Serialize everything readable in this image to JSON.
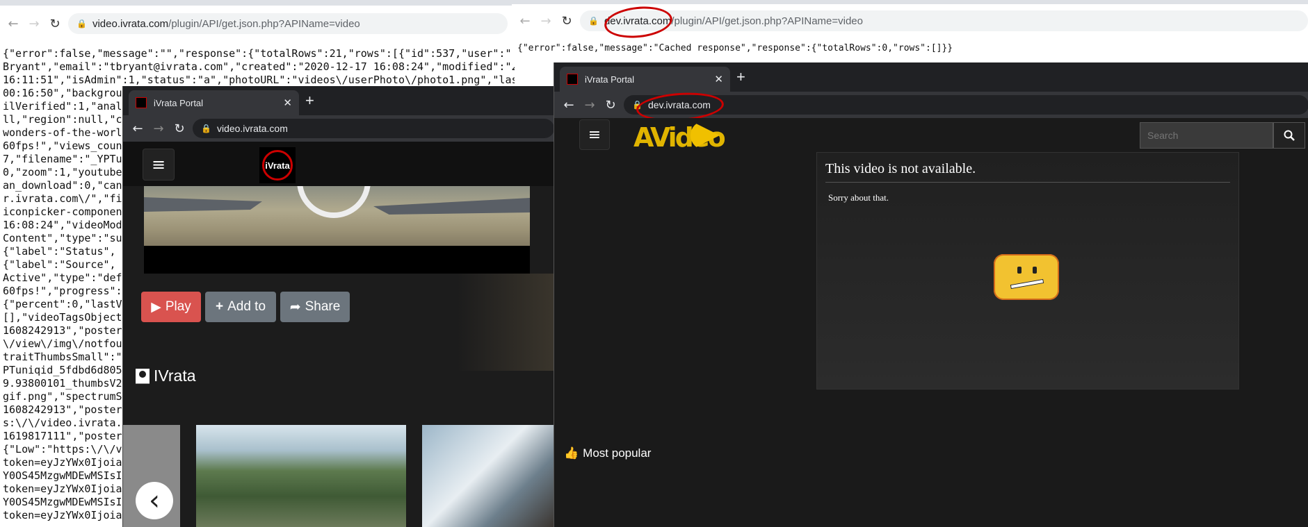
{
  "win_back": {
    "url_host": "video.ivrata.com",
    "url_path": "/plugin/API/get.json.php?APIName=video",
    "json_lines": [
      "{\"error\":false,\"message\":\"\",\"response\":{\"totalRows\":21,\"rows\":[{\"id\":537,\"user\":\"a",
      "Bryant\",\"email\":\"tbryant@ivrata.com\",\"created\":\"2020-12-17 16:08:24\",\"modified\":\"2",
      "16:11:51\",\"isAdmin\":1,\"status\":\"a\",\"photoURL\":\"videos\\/userPhoto\\/photo1.png\",\"las",
      "00:16:50\",\"backgrou",
      "ilVerified\":1,\"anal",
      "ll,\"region\":null,\"c",
      "wonders-of-the-worl",
      "60fps!\",\"views_coun",
      "7,\"filename\":\"_YPTu",
      "0,\"zoom\":1,\"youtube",
      "an_download\":0,\"can",
      "r.ivrata.com\\/\",\"fi",
      "iconpicker-componen",
      "16:08:24\",\"videoMod",
      "Content\",\"type\":\"su",
      "{\"label\":\"Status\",",
      "{\"label\":\"Source\",",
      "Active\",\"type\":\"def",
      "60fps!\",\"progress\":",
      "{\"percent\":0,\"lastV",
      "[],\"videoTagsObject",
      "1608242913\",\"poster",
      "\\/view\\/img\\/notfou",
      "traitThumbsSmall\":\"",
      "PTuniqid_5fdbd6d805",
      "9.93800101_thumbsV2",
      "gif.png\",\"spectrumS",
      "1608242913\",\"poster",
      "s:\\/\\/video.ivrata.",
      "1619817111\",\"poster",
      "{\"Low\":\"https:\\/\\/v",
      "token=eyJzYWx0Ijoia",
      "Y0OS45MzgwMDEwMSIsI",
      "token=eyJzYWx0Ijoia",
      "Y0OS45MzgwMDEwMSIsI",
      "token=eyJzYWx0Ijoia"
    ]
  },
  "win_dev": {
    "url_host": "dev.ivrata.com",
    "url_path": "/plugin/API/get.json.php?APIName=video",
    "json": "{\"error\":false,\"message\":\"Cached response\",\"response\":{\"totalRows\":0,\"rows\":[]}}"
  },
  "popup_video": {
    "tab_title": "iVrata Portal",
    "url": "video.ivrata.com",
    "logo_text": "iVrata",
    "buttons": {
      "play": "Play",
      "add": "Add to",
      "share": "Share"
    },
    "channel_name": "IVrata"
  },
  "popup_dev": {
    "tab_title": "iVrata Portal",
    "url": "dev.ivrata.com",
    "logo_text": "AVideo",
    "search_placeholder": "Search",
    "error_title": "This video is not  available.",
    "error_message": "Sorry about that.",
    "most_popular": "Most popular"
  },
  "colors": {
    "play_button": "#d9534f",
    "secondary_button": "#6c757d",
    "annotation": "#cc0000"
  }
}
